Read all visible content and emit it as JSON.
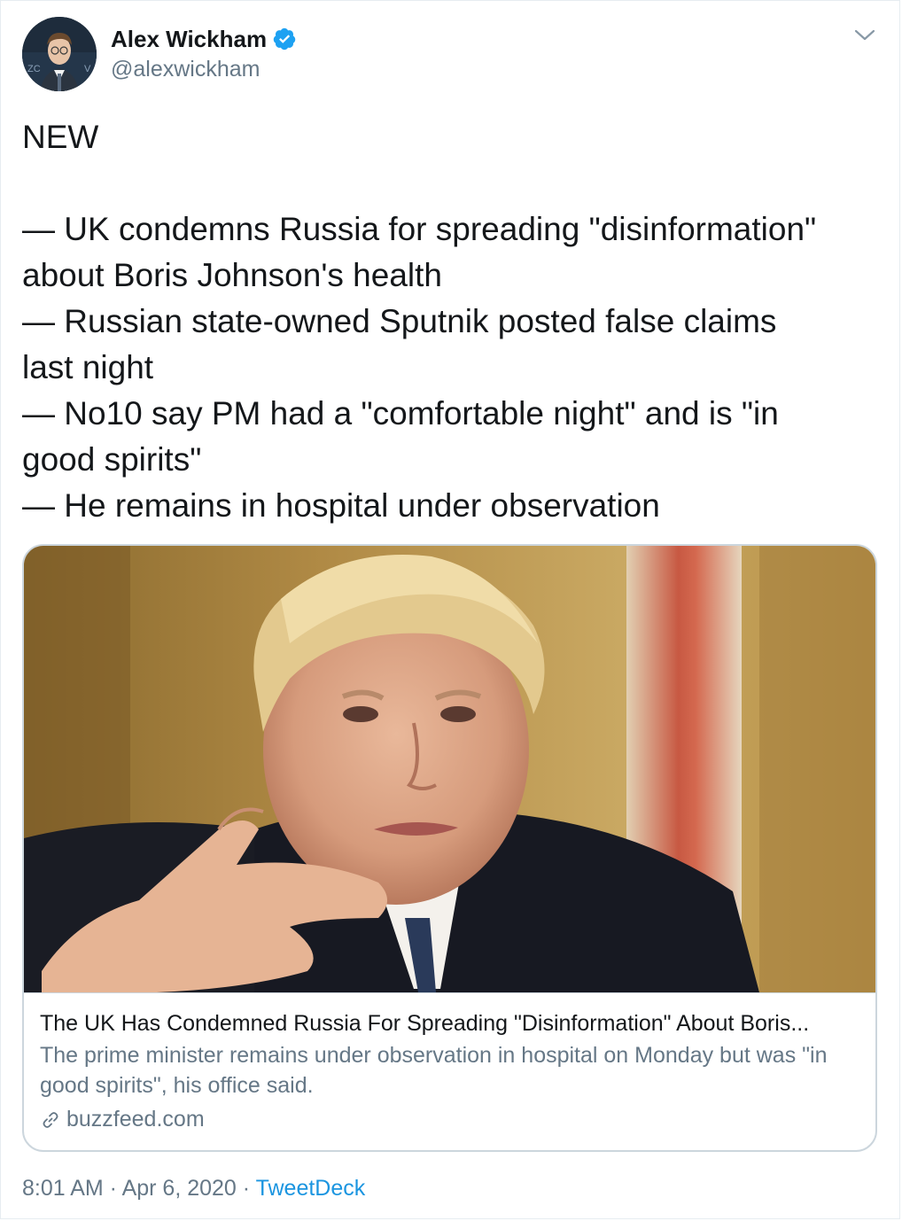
{
  "author": {
    "display_name": "Alex Wickham",
    "handle": "@alexwickham",
    "verified": true,
    "avatar_icon": "avatar-photo"
  },
  "tweet": {
    "lines": [
      "NEW",
      "",
      "— UK condemns Russia for spreading \"disinformation\"",
      "about Boris Johnson's health",
      "— Russian state-owned Sputnik posted false claims",
      "last night",
      "— No10 say PM had a \"comfortable night\" and is \"in",
      "good spirits\"",
      "— He remains in hospital under observation"
    ]
  },
  "card": {
    "title": "The UK Has Condemned Russia For Spreading \"Disinformation\" About Boris...",
    "description": "The prime minister remains under observation in hospital on Monday but was \"in good spirits\", his office said.",
    "domain": "buzzfeed.com",
    "link_icon": "link-icon"
  },
  "meta": {
    "time": "8:01 AM",
    "separator": " · ",
    "date": "Apr 6, 2020",
    "source": "TweetDeck"
  },
  "colors": {
    "text": "#14171a",
    "secondary": "#657786",
    "link": "#1b95e0",
    "verified": "#1da1f2",
    "border": "#ccd6dd"
  }
}
